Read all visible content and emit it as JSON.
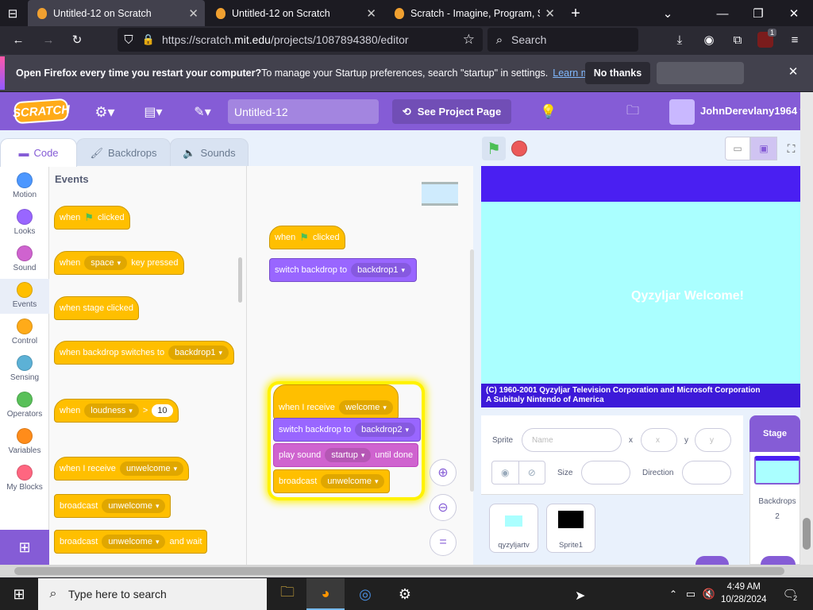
{
  "browser": {
    "tabs": [
      {
        "title": "Untitled-12 on Scratch",
        "active": true
      },
      {
        "title": "Untitled-12 on Scratch",
        "active": false
      },
      {
        "title": "Scratch - Imagine, Program, Sha",
        "active": false
      }
    ],
    "url_prefix": "https://scratch.",
    "url_domain": "mit.edu",
    "url_path": "/projects/1087894380/editor",
    "search_placeholder": "Search",
    "ext_badge": "1"
  },
  "notification": {
    "bold": "Open Firefox every time you restart your computer?",
    "text": " To manage your Startup preferences, search \"startup\" in settings.",
    "link": "Learn more",
    "no_thanks": "No thanks"
  },
  "scratch": {
    "logo": "SCRATCH",
    "project_title": "Untitled-12",
    "see_project": "See Project Page",
    "username": "JohnDerevlany1964",
    "tabs": {
      "code": "Code",
      "backdrops": "Backdrops",
      "sounds": "Sounds"
    },
    "categories": [
      {
        "label": "Motion",
        "color": "#4c97ff"
      },
      {
        "label": "Looks",
        "color": "#9966ff"
      },
      {
        "label": "Sound",
        "color": "#cf63cf"
      },
      {
        "label": "Events",
        "color": "#ffbf00"
      },
      {
        "label": "Control",
        "color": "#ffab19"
      },
      {
        "label": "Sensing",
        "color": "#5cb1d6"
      },
      {
        "label": "Operators",
        "color": "#59c059"
      },
      {
        "label": "Variables",
        "color": "#ff8c1a"
      },
      {
        "label": "My Blocks",
        "color": "#ff6680"
      }
    ],
    "palette": {
      "heading": "Events",
      "b1_a": "when",
      "b1_b": "clicked",
      "b2_a": "when",
      "b2_key": "space",
      "b2_b": "key pressed",
      "b3": "when stage clicked",
      "b4_a": "when backdrop switches to",
      "b4_dd": "backdrop1",
      "b5_a": "when",
      "b5_dd": "loudness",
      "b5_op": ">",
      "b5_num": "10",
      "b6_a": "when I receive",
      "b6_dd": "unwelcome",
      "b7_a": "broadcast",
      "b7_dd": "unwelcome",
      "b8_a": "broadcast",
      "b8_dd": "unwelcome",
      "b8_b": "and wait"
    },
    "script1": {
      "hat_a": "when",
      "hat_b": "clicked",
      "switch": "switch backdrop to",
      "switch_dd": "backdrop1"
    },
    "script2": {
      "hat": "when I receive",
      "hat_dd": "welcome",
      "switch": "switch backdrop to",
      "switch_dd": "backdrop2",
      "play": "play sound",
      "play_dd": "startup",
      "play_b": "until done",
      "bc": "broadcast",
      "bc_dd": "unwelcome"
    },
    "stage": {
      "welcome": "Qyzyljar Welcome!",
      "credit1": "(C) 1960-2001 Qyzyljar Television Corporation and Microsoft Corporation",
      "credit2": "A Subitaly Nintendo of America"
    },
    "sprite_info": {
      "sprite_label": "Sprite",
      "name_placeholder": "Name",
      "x_label": "x",
      "x_placeholder": "x",
      "y_label": "y",
      "y_placeholder": "y",
      "size_label": "Size",
      "direction_label": "Direction"
    },
    "sprites": [
      {
        "name": "qyzyljartv",
        "color": "#aaffff"
      },
      {
        "name": "Sprite1",
        "color": "#000000"
      }
    ],
    "stage_pane": {
      "title": "Stage",
      "backdrops_label": "Backdrops",
      "backdrops_count": "2"
    }
  },
  "taskbar": {
    "search_placeholder": "Type here to search",
    "time": "4:49 AM",
    "date": "10/28/2024",
    "notif_count": "2"
  }
}
